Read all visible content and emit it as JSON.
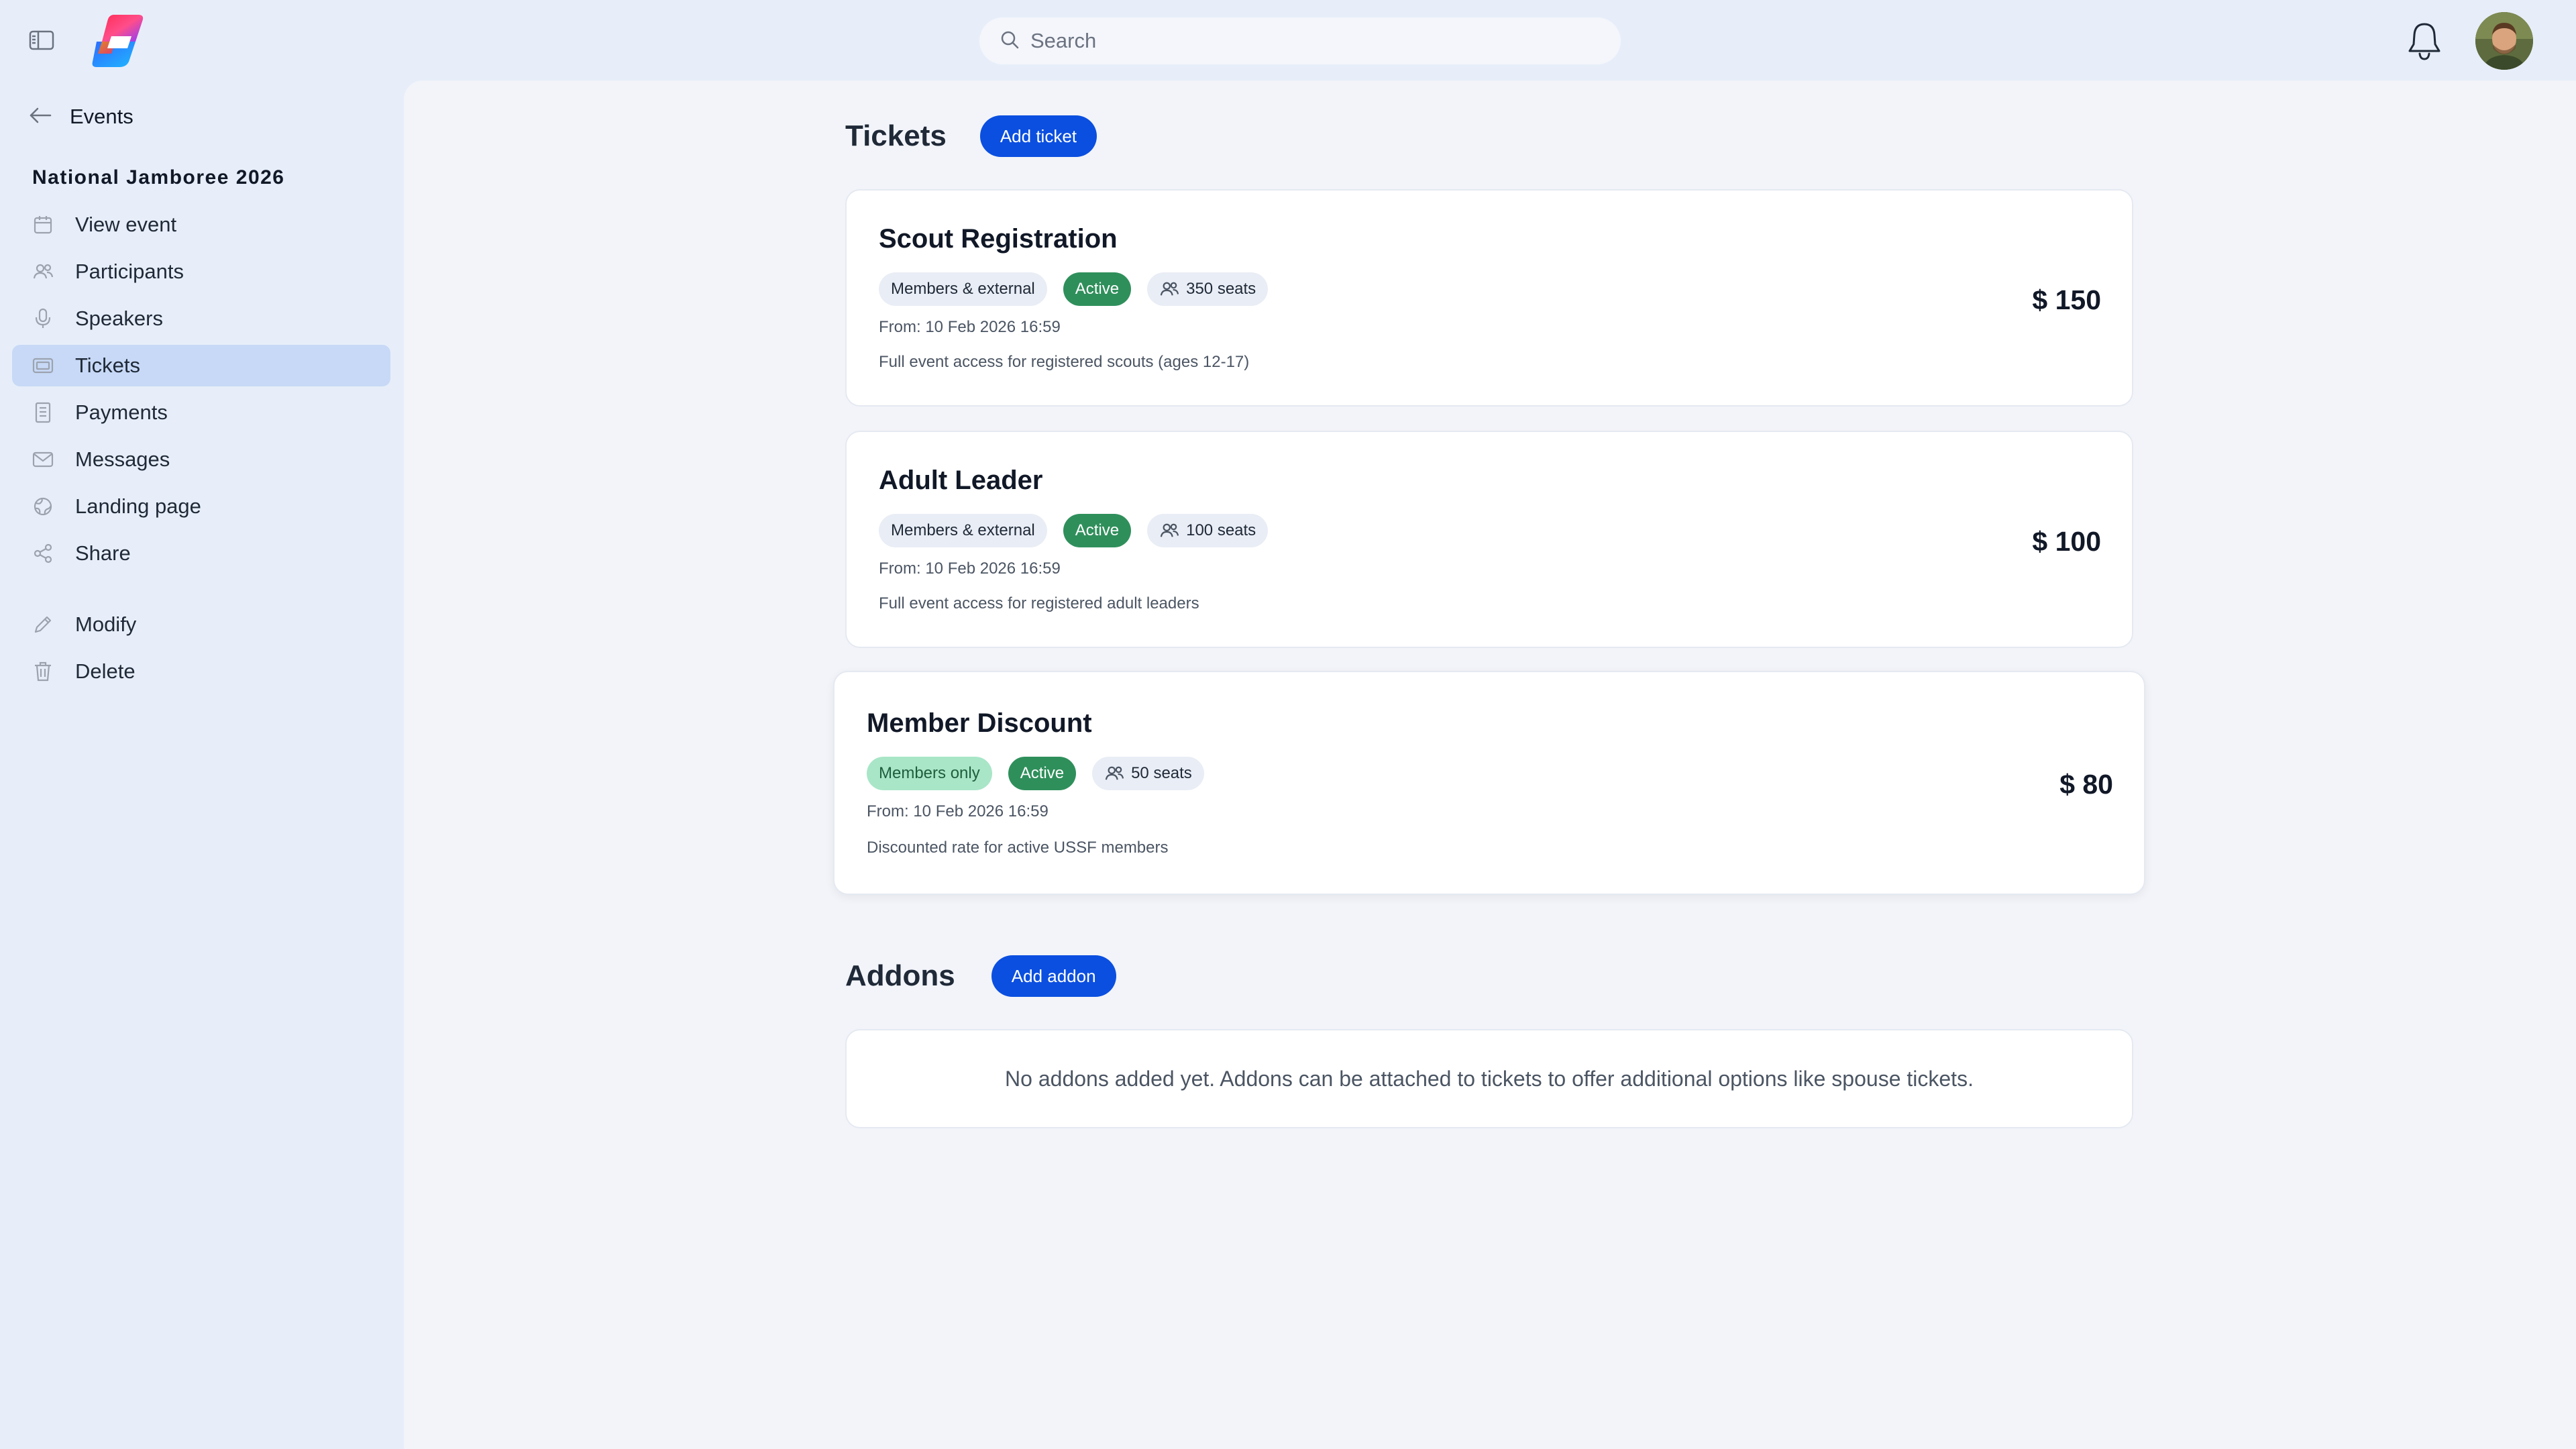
{
  "header": {
    "search_placeholder": "Search",
    "icons": {
      "sidebar_toggle": "sidebar-toggle-icon",
      "search": "search-icon",
      "notifications": "bell-icon"
    }
  },
  "sidebar": {
    "back_label": "Events",
    "event_title": "National Jamboree 2026",
    "items": [
      {
        "label": "View event",
        "icon": "calendar-icon"
      },
      {
        "label": "Participants",
        "icon": "users-icon"
      },
      {
        "label": "Speakers",
        "icon": "microphone-icon"
      },
      {
        "label": "Tickets",
        "icon": "ticket-icon",
        "active": true
      },
      {
        "label": "Payments",
        "icon": "receipt-icon"
      },
      {
        "label": "Messages",
        "icon": "mail-icon"
      },
      {
        "label": "Landing page",
        "icon": "globe-icon"
      },
      {
        "label": "Share",
        "icon": "share-icon"
      }
    ],
    "actions": [
      {
        "label": "Modify",
        "icon": "pencil-icon"
      },
      {
        "label": "Delete",
        "icon": "trash-icon"
      }
    ]
  },
  "tickets": {
    "heading": "Tickets",
    "add_label": "Add ticket",
    "items": [
      {
        "name": "Scout Registration",
        "audience": "Members & external",
        "status": "Active",
        "seats": "350 seats",
        "from": "From: 10 Feb 2026 16:59",
        "description": "Full event access for registered scouts (ages 12-17)",
        "price": "$ 150"
      },
      {
        "name": "Adult Leader",
        "audience": "Members & external",
        "status": "Active",
        "seats": "100 seats",
        "from": "From: 10 Feb 2026 16:59",
        "description": "Full event access for registered adult leaders",
        "price": "$ 100"
      },
      {
        "name": "Member Discount",
        "audience": "Members only",
        "status": "Active",
        "seats": "50 seats",
        "from": "From: 10 Feb 2026 16:59",
        "description": "Discounted rate for active USSF members",
        "price": "$ 80"
      }
    ]
  },
  "addons": {
    "heading": "Addons",
    "add_label": "Add addon",
    "empty_text": "No addons added yet. Addons can be attached to tickets to offer additional options like spouse tickets."
  },
  "colors": {
    "accent": "#0b4fe0",
    "active_badge": "#2f8f5b",
    "members_only_badge": "#a8e6c7",
    "sidebar_bg": "#e7eef9",
    "active_nav_bg": "#c7d9f6"
  }
}
